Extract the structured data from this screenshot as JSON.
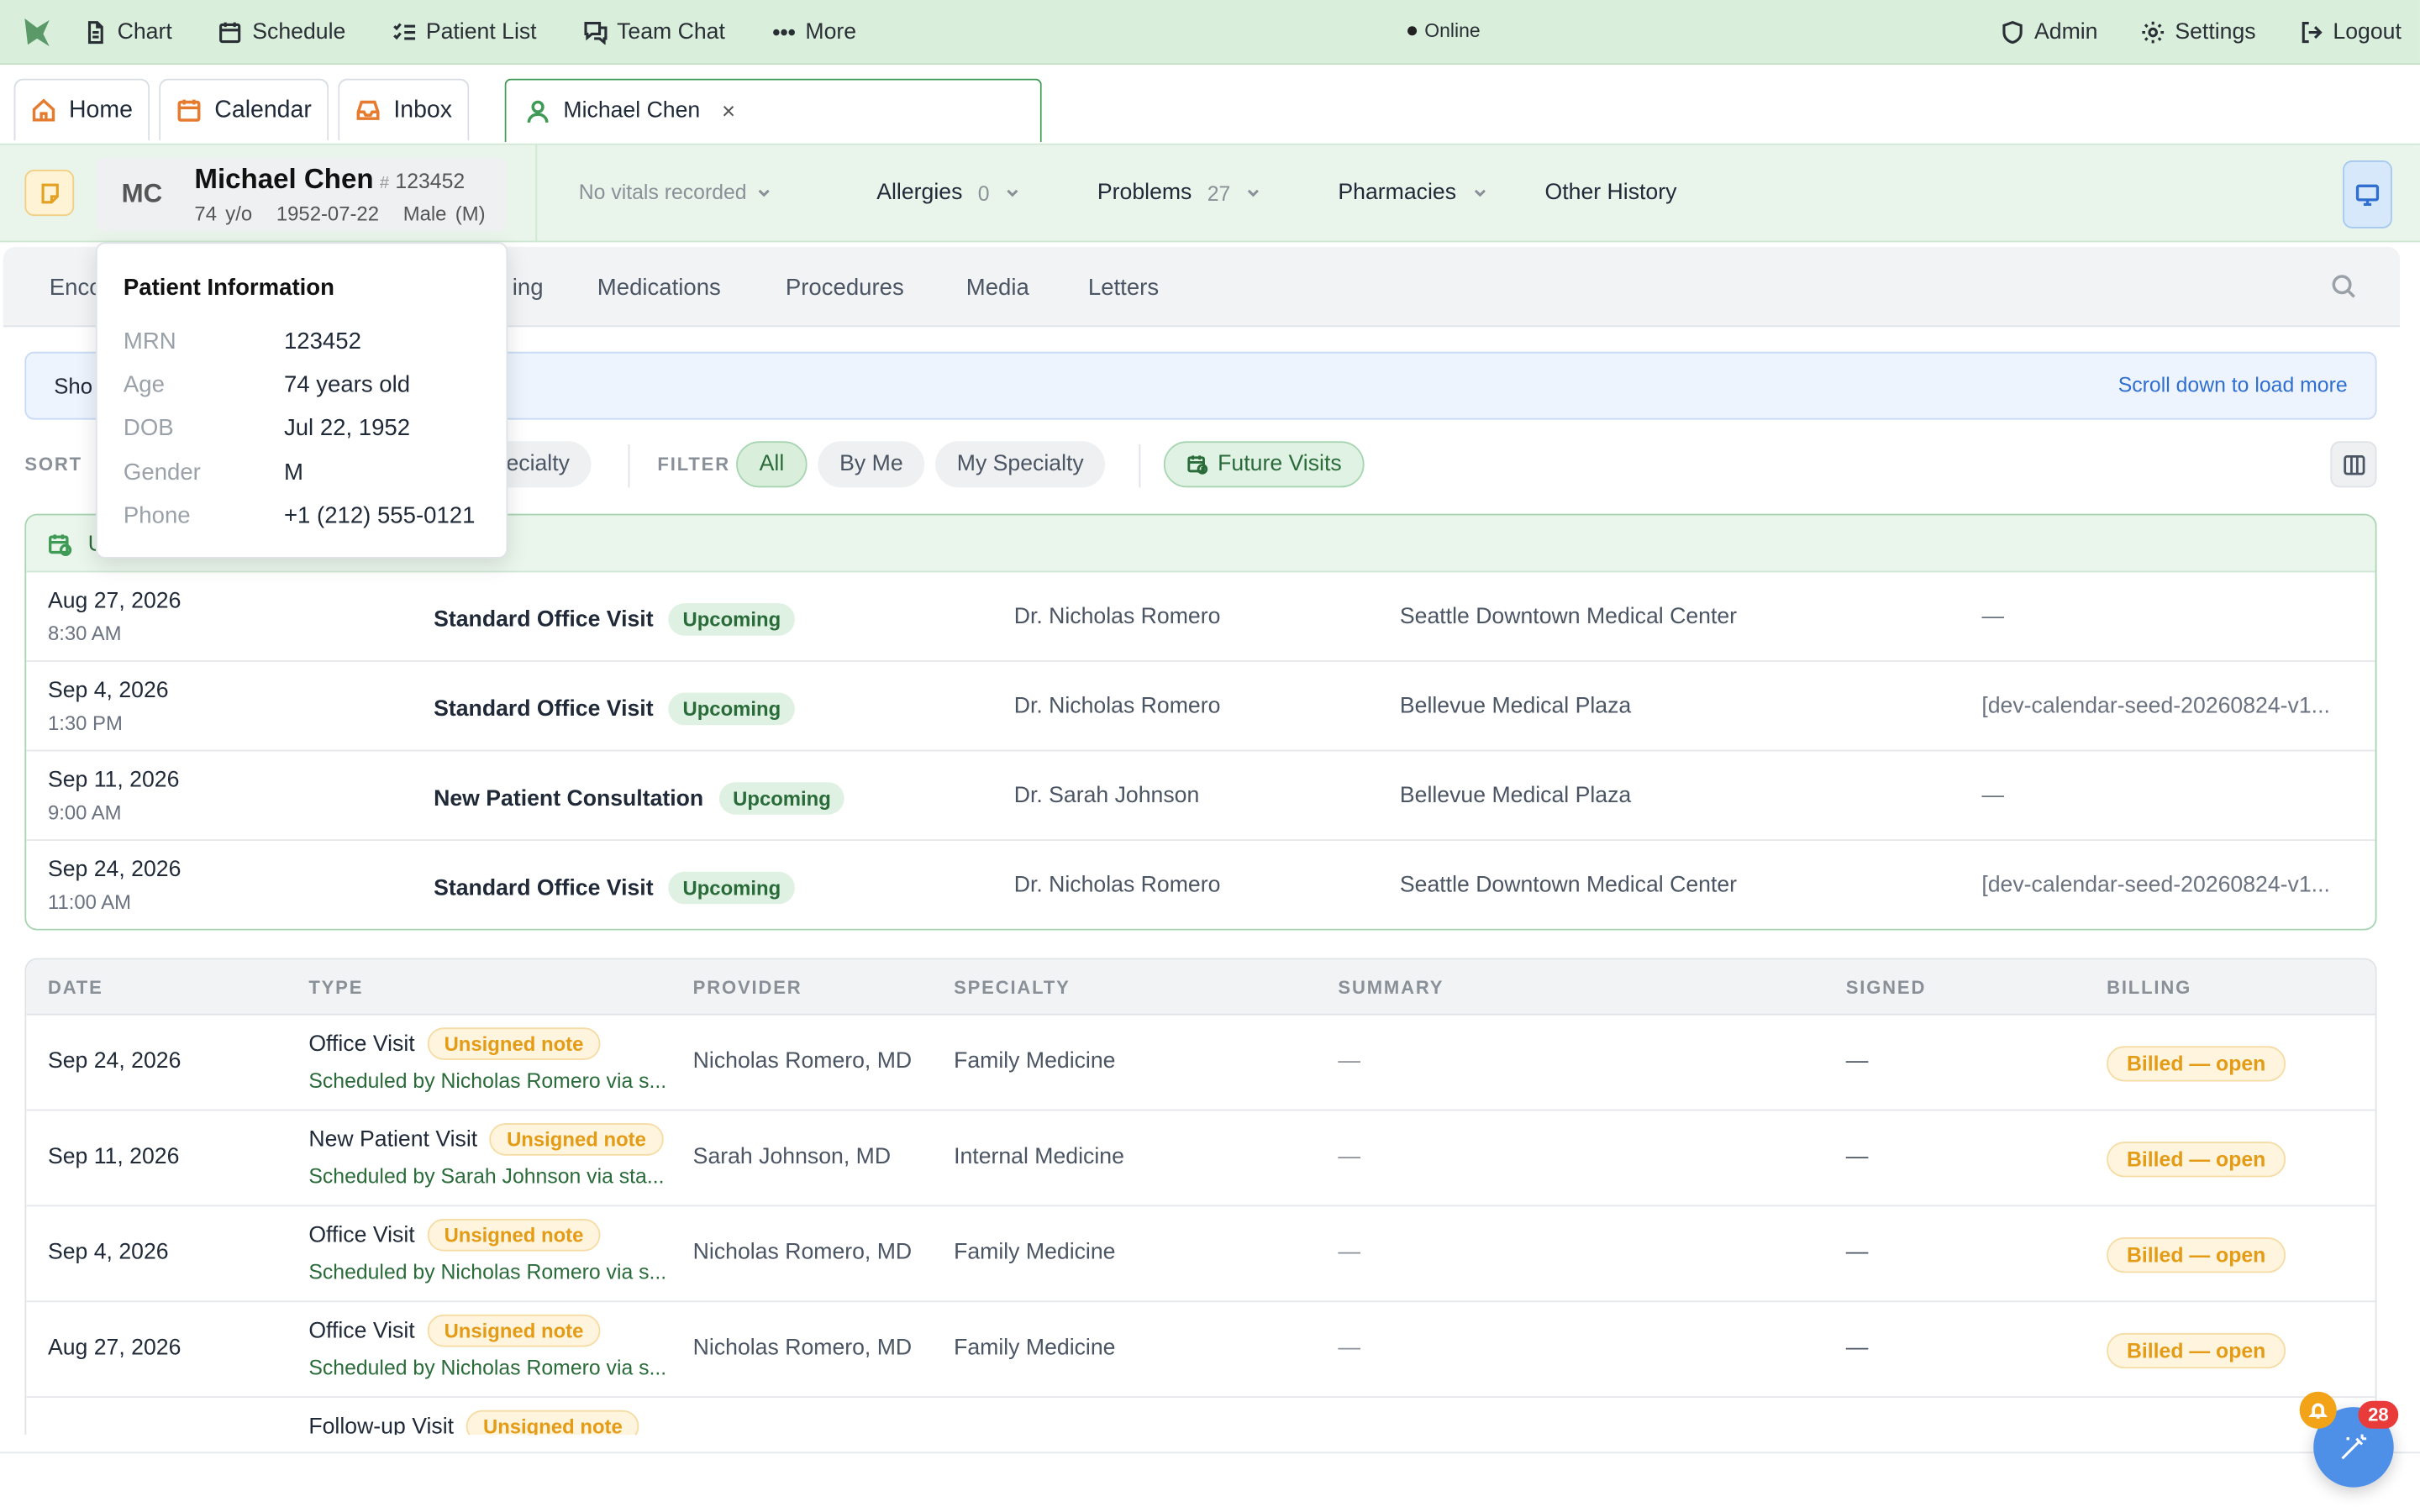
{
  "topnav": {
    "items": [
      {
        "label": "Chart",
        "icon": "document-icon"
      },
      {
        "label": "Schedule",
        "icon": "calendar-icon"
      },
      {
        "label": "Patient List",
        "icon": "checklist-icon"
      },
      {
        "label": "Team Chat",
        "icon": "chat-icon"
      },
      {
        "label": "More",
        "icon": "ellipsis-icon"
      }
    ],
    "status": "Online",
    "right": [
      {
        "label": "Admin",
        "icon": "shield-icon"
      },
      {
        "label": "Settings",
        "icon": "gear-icon"
      },
      {
        "label": "Logout",
        "icon": "logout-icon"
      }
    ]
  },
  "tabs": [
    {
      "label": "Home"
    },
    {
      "label": "Calendar"
    },
    {
      "label": "Inbox"
    },
    {
      "label": "Michael Chen",
      "close": "×"
    }
  ],
  "patient": {
    "initials": "MC",
    "name": "Michael Chen",
    "mrn_hash": "#",
    "mrn": "123452",
    "age": "74 y/o",
    "dob": "1952-07-22",
    "sex": "Male (M)",
    "vitals": "No vitals recorded",
    "allergies_label": "Allergies",
    "allergies_count": "0",
    "problems_label": "Problems",
    "problems_count": "27",
    "pharmacies_label": "Pharmacies",
    "other_history_label": "Other History"
  },
  "section_tabs": [
    "Enco",
    "ing",
    "Medications",
    "Procedures",
    "Media",
    "Letters"
  ],
  "banner": {
    "label": "Sho",
    "more": "Scroll down to load more"
  },
  "sortrow": {
    "sort_label": "SORT",
    "sort_pill": "ecialty",
    "filter_label": "FILTER",
    "filters": [
      "All",
      "By Me",
      "My Specialty"
    ],
    "future_visits": "Future Visits"
  },
  "upcoming_head_label": "U",
  "upcoming": [
    {
      "date": "Aug 27, 2026",
      "time": "8:30 AM",
      "type": "Standard Office Visit",
      "status": "Upcoming",
      "provider": "Dr. Nicholas Romero",
      "location": "Seattle Downtown Medical Center",
      "extra": "—"
    },
    {
      "date": "Sep 4, 2026",
      "time": "1:30 PM",
      "type": "Standard Office Visit",
      "status": "Upcoming",
      "provider": "Dr. Nicholas Romero",
      "location": "Bellevue Medical Plaza",
      "extra": "[dev-calendar-seed-20260824-v1..."
    },
    {
      "date": "Sep 11, 2026",
      "time": "9:00 AM",
      "type": "New Patient Consultation",
      "status": "Upcoming",
      "provider": "Dr. Sarah Johnson",
      "location": "Bellevue Medical Plaza",
      "extra": "—"
    },
    {
      "date": "Sep 24, 2026",
      "time": "11:00 AM",
      "type": "Standard Office Visit",
      "status": "Upcoming",
      "provider": "Dr. Nicholas Romero",
      "location": "Seattle Downtown Medical Center",
      "extra": "[dev-calendar-seed-20260824-v1..."
    }
  ],
  "encounters": {
    "columns": [
      "DATE",
      "TYPE",
      "PROVIDER",
      "SPECIALTY",
      "SUMMARY",
      "SIGNED",
      "BILLING"
    ],
    "rows": [
      {
        "date": "Sep 24, 2026",
        "type": "Office Visit",
        "status": "Unsigned note",
        "sched": "Scheduled by Nicholas Romero via s...",
        "provider": "Nicholas Romero, MD",
        "specialty": "Family Medicine",
        "summary": "—",
        "signed": "—",
        "billing": "Billed — open"
      },
      {
        "date": "Sep 11, 2026",
        "type": "New Patient Visit",
        "status": "Unsigned note",
        "sched": "Scheduled by Sarah Johnson via sta...",
        "provider": "Sarah Johnson, MD",
        "specialty": "Internal Medicine",
        "summary": "—",
        "signed": "—",
        "billing": "Billed — open"
      },
      {
        "date": "Sep 4, 2026",
        "type": "Office Visit",
        "status": "Unsigned note",
        "sched": "Scheduled by Nicholas Romero via s...",
        "provider": "Nicholas Romero, MD",
        "specialty": "Family Medicine",
        "summary": "—",
        "signed": "—",
        "billing": "Billed — open"
      },
      {
        "date": "Aug 27, 2026",
        "type": "Office Visit",
        "status": "Unsigned note",
        "sched": "Scheduled by Nicholas Romero via s...",
        "provider": "Nicholas Romero, MD",
        "specialty": "Family Medicine",
        "summary": "—",
        "signed": "—",
        "billing": "Billed — open"
      },
      {
        "date": "",
        "type": "Follow-up Visit",
        "status": "Unsigned note",
        "sched": "",
        "provider": "",
        "specialty": "",
        "summary": "",
        "signed": "",
        "billing": ""
      }
    ]
  },
  "popover": {
    "title": "Patient Information",
    "fields": [
      {
        "k": "MRN",
        "v": "123452"
      },
      {
        "k": "Age",
        "v": "74 years old"
      },
      {
        "k": "DOB",
        "v": "Jul 22, 1952"
      },
      {
        "k": "Gender",
        "v": "M"
      },
      {
        "k": "Phone",
        "v": "+1 (212) 555-0121"
      }
    ]
  },
  "fab": {
    "count": "28"
  },
  "colors": {
    "accent_green": "#3f9a55",
    "header_green": "#d9efdc",
    "warning": "#e49b16",
    "link_blue": "#2f6fd0"
  }
}
